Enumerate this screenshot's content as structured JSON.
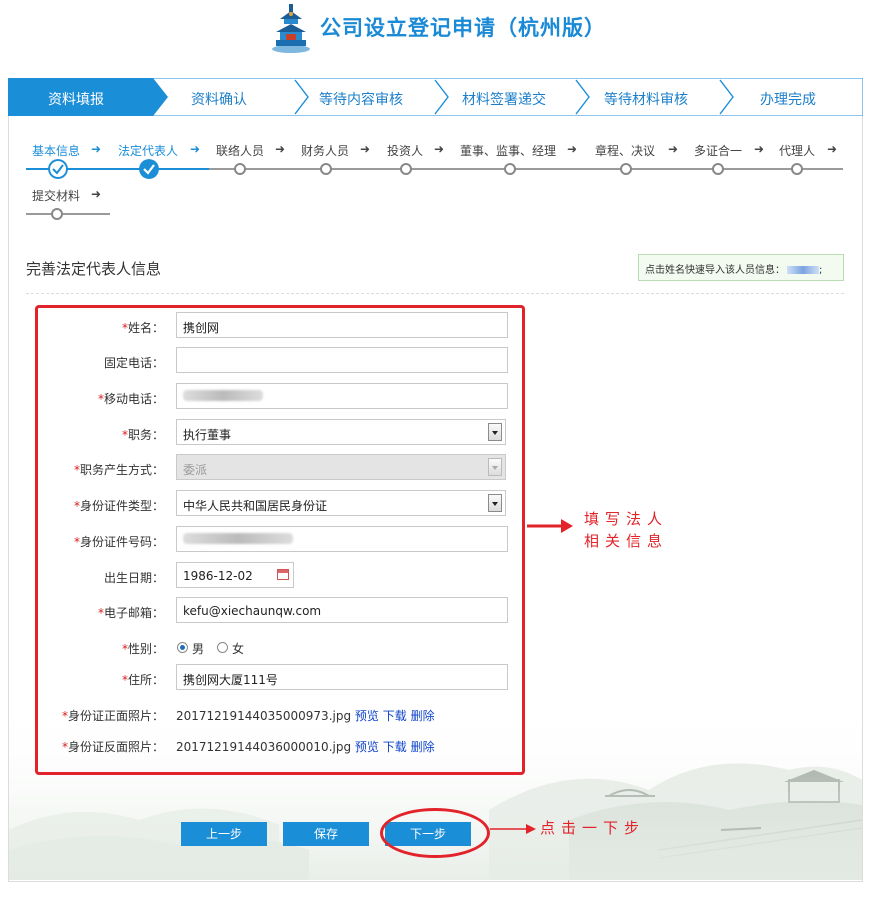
{
  "app_title": "公司设立登记申请（杭州版）",
  "main_steps": [
    {
      "label": "资料填报",
      "active": true
    },
    {
      "label": "资料确认",
      "active": false
    },
    {
      "label": "等待内容审核",
      "active": false
    },
    {
      "label": "材料签署递交",
      "active": false
    },
    {
      "label": "等待材料审核",
      "active": false
    },
    {
      "label": "办理完成",
      "active": false
    }
  ],
  "sub_steps": [
    {
      "label": "基本信息",
      "done": true
    },
    {
      "label": "法定代表人",
      "done": true
    },
    {
      "label": "联络人员",
      "done": false
    },
    {
      "label": "财务人员",
      "done": false
    },
    {
      "label": "投资人",
      "done": false
    },
    {
      "label": "董事、监事、经理",
      "done": false
    },
    {
      "label": "章程、决议",
      "done": false
    },
    {
      "label": "多证合一",
      "done": false
    },
    {
      "label": "代理人",
      "done": false
    },
    {
      "label": "提交材料",
      "done": false
    }
  ],
  "sub_step_arrow": "➜",
  "section_title": "完善法定代表人信息",
  "quick_import": {
    "text": "点击姓名快速导入该人员信息：",
    "suffix": ";"
  },
  "form": {
    "required_mark": "*",
    "name": {
      "label": "姓名：",
      "value": "携创网"
    },
    "landline": {
      "label": "固定电话：",
      "value": ""
    },
    "mobile": {
      "label": "移动电话：",
      "value": ""
    },
    "position": {
      "label": "职务：",
      "value": "执行董事"
    },
    "position_method": {
      "label": "职务产生方式：",
      "value": "委派"
    },
    "id_type": {
      "label": "身份证件类型：",
      "value": "中华人民共和国居民身份证"
    },
    "id_number": {
      "label": "身份证件号码：",
      "value": ""
    },
    "birth_date": {
      "label": "出生日期：",
      "value": "1986-12-02"
    },
    "email": {
      "label": "电子邮箱：",
      "value": "kefu@xiechaunqw.com"
    },
    "gender": {
      "label": "性别：",
      "options": [
        "男",
        "女"
      ],
      "selected": "男"
    },
    "address": {
      "label": "住所：",
      "value": "携创网大厦111号"
    },
    "id_front": {
      "label": "身份证正面照片：",
      "file": "20171219144035000973.jpg"
    },
    "id_back": {
      "label": "身份证反面照片：",
      "file": "20171219144036000010.jpg"
    },
    "file_actions": {
      "preview": "预览",
      "download": "下载",
      "delete": "删除"
    }
  },
  "annotations": {
    "fill_info_line1": "填写法人",
    "fill_info_line2": "相关信息",
    "click_next": "点击一下步"
  },
  "buttons": {
    "prev": "上一步",
    "save": "保存",
    "next": "下一步"
  },
  "colors": {
    "primary": "#1b8ed8",
    "annotation_red": "#e2232a",
    "required_red": "#d9201f"
  }
}
